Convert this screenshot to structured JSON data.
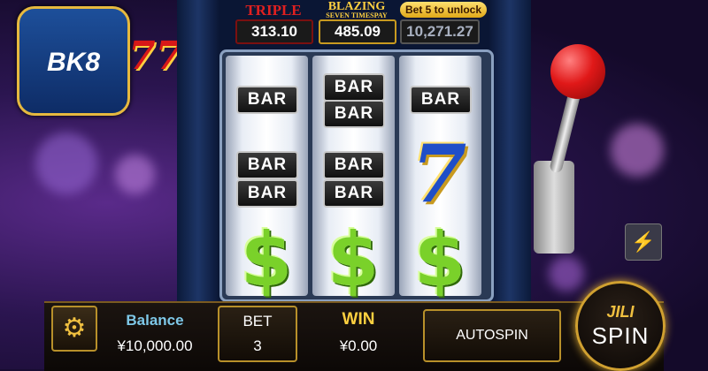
{
  "logo": {
    "text": "BK8",
    "deco": "77"
  },
  "jackpots": [
    {
      "label": "TRIPLE",
      "value": "313.10",
      "color": "#e02020"
    },
    {
      "label": "BLAZING",
      "sublabel": "SEVEN TIMESPAY",
      "value": "485.09",
      "color": "#ffd040"
    },
    {
      "label": "",
      "value": "10,271.27",
      "color": "#ffffff"
    }
  ],
  "unlock_label": "Bet 5 to unlock",
  "reels": [
    [
      "BAR",
      "BAR BAR",
      "$"
    ],
    [
      "BAR BAR",
      "BAR BAR",
      "$"
    ],
    [
      "BAR",
      "7",
      "$"
    ]
  ],
  "bottom_bar": {
    "balance_label": "Balance",
    "balance_value": "¥10,000.00",
    "bet_label": "BET",
    "bet_value": "3",
    "win_label": "WIN",
    "win_value": "¥0.00",
    "autospin_label": "AUTOSPIN",
    "spin_brand": "JILI",
    "spin_label": "SPIN"
  },
  "icons": {
    "settings": "gear-icon",
    "turbo": "lightning-icon"
  }
}
